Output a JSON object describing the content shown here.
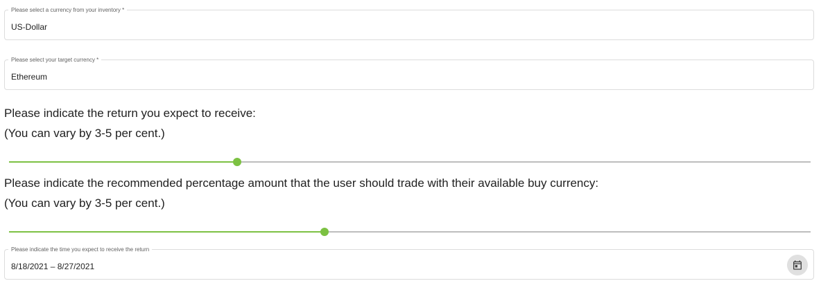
{
  "source_currency": {
    "label": "Please select a currency from your inventory *",
    "value": "US-Dollar"
  },
  "target_currency": {
    "label": "Please select your target currency *",
    "value": "Ethereum"
  },
  "expected_return": {
    "question": "Please indicate the return you expect to receive:",
    "hint": "(You can vary by 3-5 per cent.)",
    "slider_percent": 28.5
  },
  "trade_percentage": {
    "question": "Please indicate the recommended percentage amount that the user should trade with their available buy currency:",
    "hint": "(You can vary by 3-5 per cent.)",
    "slider_percent": 39.4
  },
  "return_time": {
    "label": "Please indicate the time you expect to receive the return",
    "value": "8/18/2021 – 8/27/2021",
    "icon": "calendar-icon"
  },
  "colors": {
    "accent": "#7cc142",
    "track": "#bdbdbd",
    "border": "#dcdcdc"
  }
}
